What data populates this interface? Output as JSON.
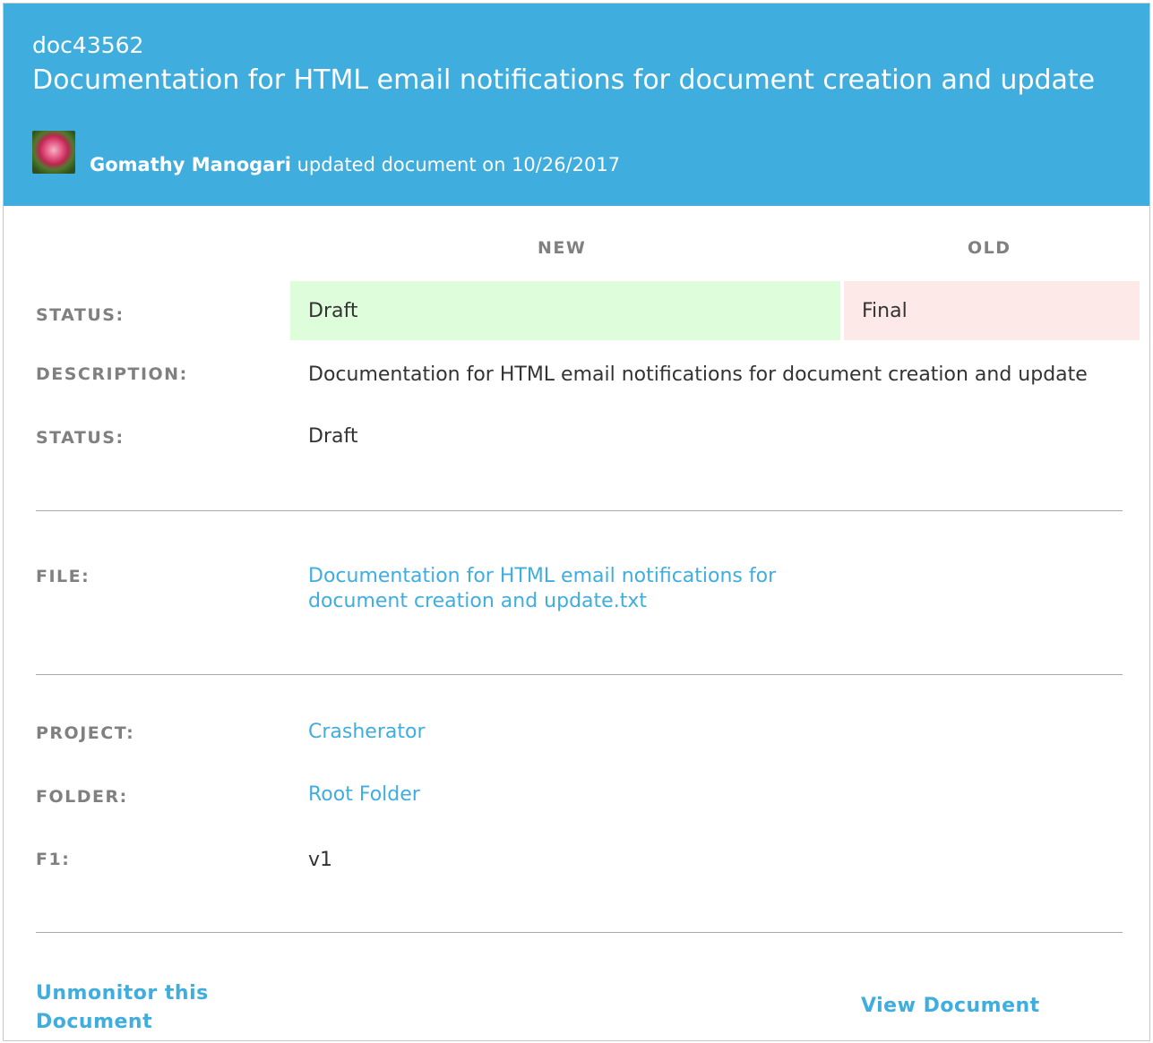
{
  "header": {
    "doc_id": "doc43562",
    "title": "Documentation for HTML email notifications for document creation and update",
    "user_name": "Gomathy Manogari",
    "action_text": "updated document on 10/26/2017",
    "avatar_icon": "rose-avatar"
  },
  "changes": {
    "new_header": "NEW",
    "old_header": "OLD",
    "status_label": "STATUS:",
    "status_new": "Draft",
    "status_old": "Final"
  },
  "details": {
    "description_label": "DESCRIPTION:",
    "description_value": "Documentation for HTML email notifications for document creation and update",
    "status_label": "STATUS:",
    "status_value": "Draft",
    "file_label": "FILE:",
    "file_line1": "Documentation for HTML email notifications for",
    "file_line2": "document creation and update.txt",
    "project_label": "PROJECT:",
    "project_value": "Crasherator",
    "folder_label": "FOLDER:",
    "folder_value": "Root Folder",
    "f1_label": "F1:",
    "f1_value": "v1"
  },
  "footer": {
    "unmonitor_line1": "Unmonitor this",
    "unmonitor_line2": "Document",
    "view_document": "View Document"
  },
  "colors": {
    "header_bg": "#3fadde",
    "new_bg": "#ddfddb",
    "old_bg": "#fde9e7",
    "link": "#3fadde",
    "label": "#808080"
  }
}
